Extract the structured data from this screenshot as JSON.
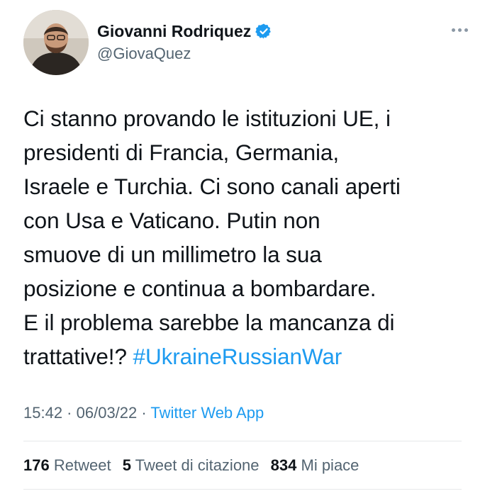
{
  "user": {
    "display_name": "Giovanni Rodriquez",
    "handle": "@GiovaQuez",
    "verified": true
  },
  "tweet": {
    "lines": [
      "Ci stanno provando le istituzioni UE, i",
      "presidenti di Francia, Germania,",
      "Israele e Turchia. Ci sono canali aperti",
      "con Usa e Vaticano. Putin non",
      "smuove di un millimetro la sua",
      "posizione e continua a bombardare.",
      "E il problema sarebbe la mancanza di"
    ],
    "last_line_text": "trattative!? ",
    "hashtag": "#UkraineRussianWar"
  },
  "meta": {
    "time": "15:42",
    "date": "06/03/22",
    "separator": " · ",
    "source": "Twitter Web App"
  },
  "stats": {
    "retweets_count": "176",
    "retweets_label": "Retweet",
    "quotes_count": "5",
    "quotes_label": "Tweet di citazione",
    "likes_count": "834",
    "likes_label": "Mi piace"
  },
  "colors": {
    "link_blue": "#1d9bf0",
    "secondary_text": "#536471",
    "primary_text": "#0f1419",
    "divider": "#e7e9ea"
  },
  "icons": [
    "verified-badge-icon",
    "more-options-icon"
  ]
}
